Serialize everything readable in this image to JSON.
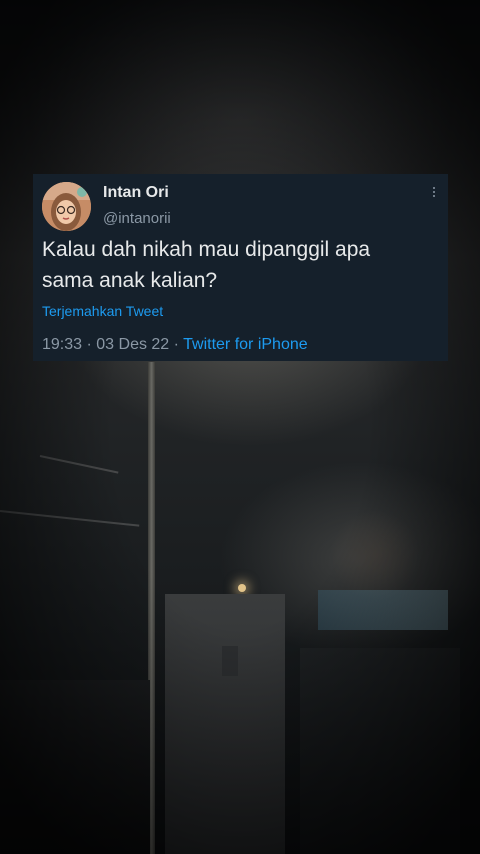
{
  "tweet": {
    "name": "Intan Ori",
    "handle": "@intanorii",
    "text_line1": "Kalau dah nikah mau dipanggil apa",
    "text_line2": "sama anak kalian?",
    "translate": "Terjemahkan Tweet",
    "time": "19:33",
    "separator": " · ",
    "date": "03 Des 22",
    "source": "Twitter for iPhone"
  },
  "icons": {
    "more": "more-options-icon",
    "avatar": "profile-avatar"
  },
  "colors": {
    "card_bg": "#15202b",
    "text": "#e7e9ea",
    "muted": "#8b98a5",
    "link": "#1d9bf0"
  }
}
